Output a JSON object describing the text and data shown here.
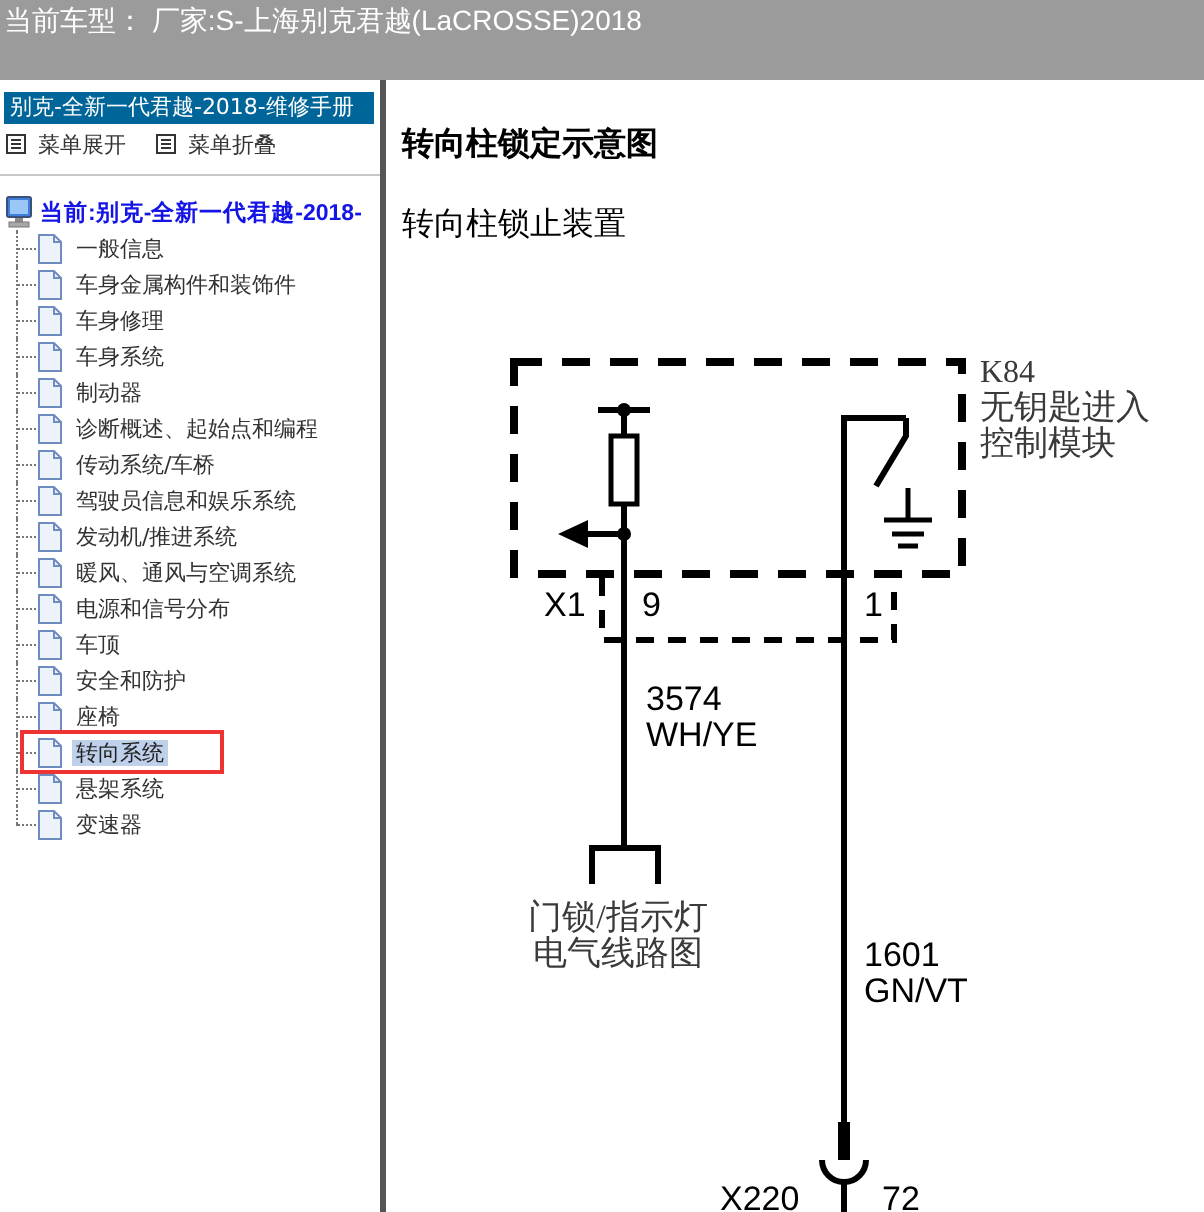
{
  "header": {
    "title": "当前车型： 厂家:S-上海别克君越(LaCROSSE)2018"
  },
  "sidebar": {
    "title": "别克-全新一代君越-2018-维修手册",
    "actions": [
      {
        "label": "菜单展开"
      },
      {
        "label": "菜单折叠"
      }
    ],
    "tree": {
      "label": "当前:别克-全新一代君越-2018-",
      "children": [
        {
          "label": "一般信息",
          "selected": false,
          "circled": false
        },
        {
          "label": "车身金属构件和装饰件",
          "selected": false,
          "circled": false
        },
        {
          "label": "车身修理",
          "selected": false,
          "circled": false
        },
        {
          "label": "车身系统",
          "selected": false,
          "circled": false
        },
        {
          "label": "制动器",
          "selected": false,
          "circled": false
        },
        {
          "label": "诊断概述、起始点和编程",
          "selected": false,
          "circled": false
        },
        {
          "label": "传动系统/车桥",
          "selected": false,
          "circled": false
        },
        {
          "label": "驾驶员信息和娱乐系统",
          "selected": false,
          "circled": false
        },
        {
          "label": "发动机/推进系统",
          "selected": false,
          "circled": false
        },
        {
          "label": "暖风、通风与空调系统",
          "selected": false,
          "circled": false
        },
        {
          "label": "电源和信号分布",
          "selected": false,
          "circled": false
        },
        {
          "label": "车顶",
          "selected": false,
          "circled": false
        },
        {
          "label": "安全和防护",
          "selected": false,
          "circled": false
        },
        {
          "label": "座椅",
          "selected": false,
          "circled": false
        },
        {
          "label": "转向系统",
          "selected": true,
          "circled": true
        },
        {
          "label": "悬架系统",
          "selected": false,
          "circled": false
        },
        {
          "label": "变速器",
          "selected": false,
          "circled": false
        }
      ]
    }
  },
  "content": {
    "title": "转向柱锁定示意图",
    "subtitle": "转向柱锁止装置",
    "diagram": {
      "module": {
        "code": "K84",
        "name_lines": [
          "无钥匙进入",
          "控制模块"
        ]
      },
      "connector": {
        "code": "X1",
        "pins": [
          "9",
          "1"
        ]
      },
      "wires": [
        {
          "circuit": "3574",
          "color_code": "WH/YE"
        },
        {
          "circuit": "1601",
          "color_code": "GN/VT"
        }
      ],
      "reference": {
        "lines": [
          "门锁/指示灯",
          "电气线路图"
        ]
      },
      "terminal": {
        "code": "X220",
        "pin": "72"
      }
    }
  }
}
